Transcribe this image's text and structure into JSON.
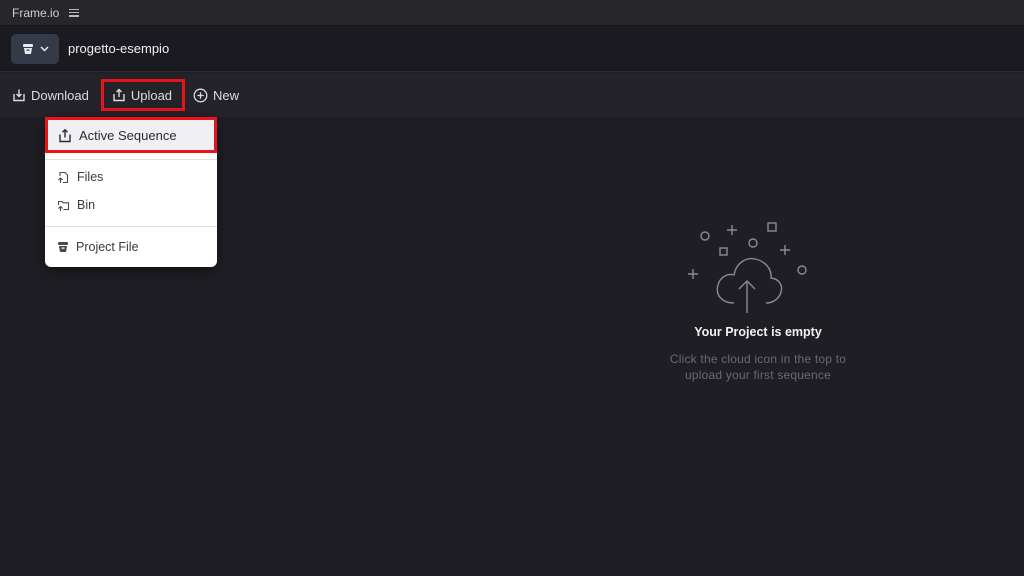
{
  "titlebar": {
    "app_name": "Frame.io",
    "menu_icon": "hamburger-icon"
  },
  "project": {
    "name": "progetto-esempio",
    "icon": "project-bin-icon"
  },
  "toolbar": {
    "download_label": "Download",
    "upload_label": "Upload",
    "new_label": "New"
  },
  "upload_menu": {
    "items": [
      {
        "label": "Active Sequence",
        "icon": "upload-icon"
      },
      {
        "label": "Files",
        "icon": "files-upload-icon"
      },
      {
        "label": "Bin",
        "icon": "bin-upload-icon"
      },
      {
        "label": "Project File",
        "icon": "project-file-icon"
      }
    ]
  },
  "empty_state": {
    "title": "Your Project is empty",
    "line1": "Click the cloud icon in the top to",
    "line2": "upload your first sequence"
  },
  "colors": {
    "highlight": "#e8141b",
    "background": "#1e1e24",
    "menu_bg": "#ffffff"
  }
}
